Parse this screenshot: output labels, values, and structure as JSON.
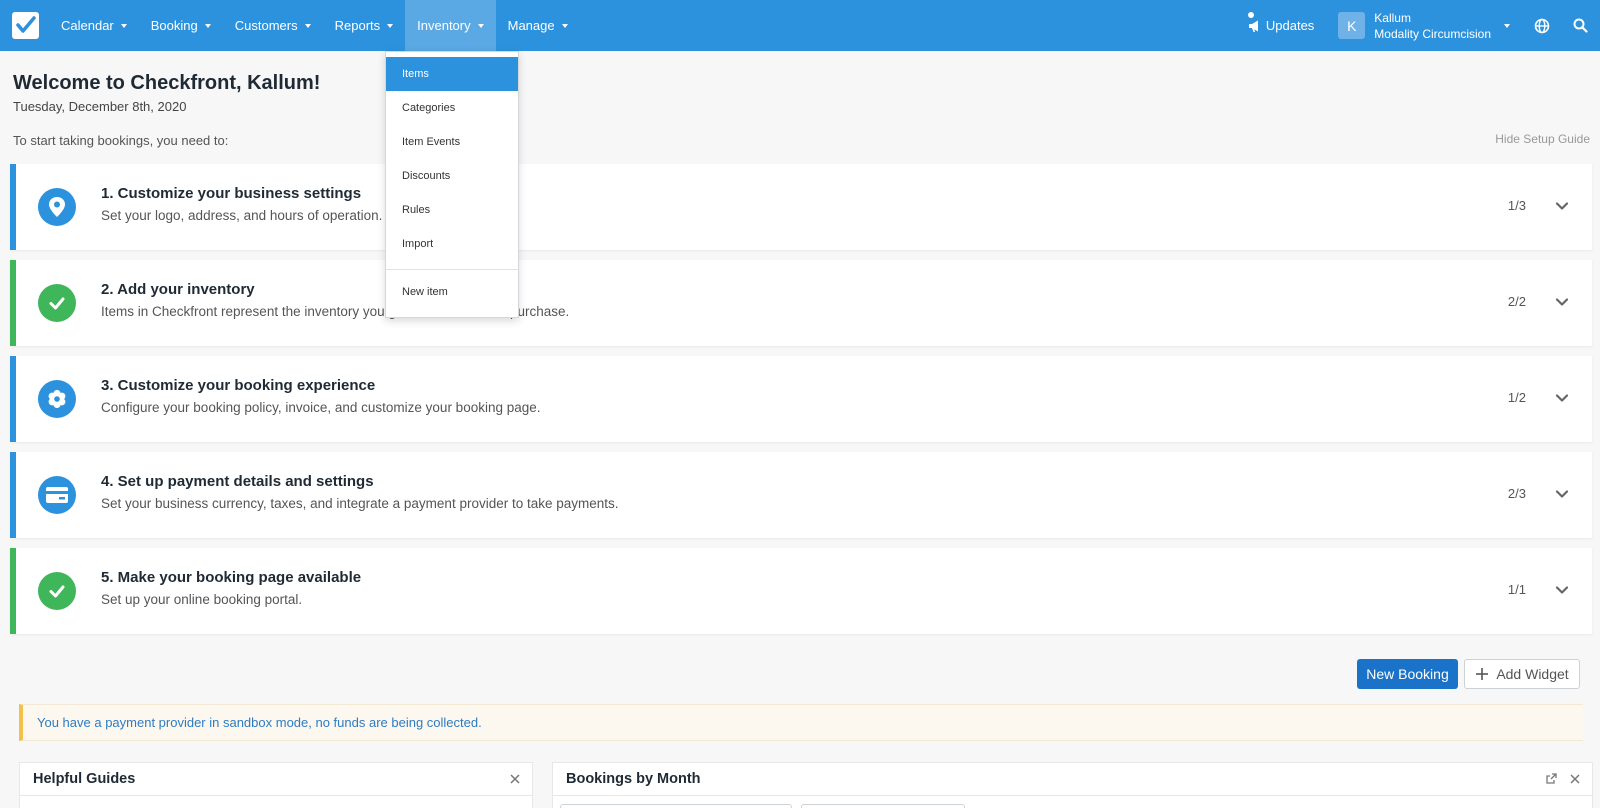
{
  "nav": {
    "items": [
      {
        "label": "Calendar"
      },
      {
        "label": "Booking"
      },
      {
        "label": "Customers"
      },
      {
        "label": "Reports"
      },
      {
        "label": "Inventory"
      },
      {
        "label": "Manage"
      }
    ],
    "active": "Inventory",
    "updates_label": "Updates",
    "user": {
      "initial": "K",
      "name": "Kallum",
      "company": "Modality Circumcision"
    }
  },
  "inventory_menu": {
    "items": [
      "Items",
      "Categories",
      "Item Events",
      "Discounts",
      "Rules",
      "Import"
    ],
    "selected": "Items",
    "new_item": "New item"
  },
  "welcome": {
    "title": "Welcome to Checkfront, Kallum!",
    "date": "Tuesday, December 8th, 2020",
    "intro": "To start taking bookings, you need to:",
    "hide_guide": "Hide Setup Guide"
  },
  "steps": [
    {
      "title": "1. Customize your business settings",
      "desc": "Set your logo, address, and hours of operation.",
      "count": "1/3",
      "icon": "location-pin-icon",
      "done": false
    },
    {
      "title": "2. Add your inventory",
      "desc": "Items in Checkfront represent the inventory you guests can book, or purchase.",
      "count": "2/2",
      "icon": "checkmark-icon",
      "done": true
    },
    {
      "title": "3. Customize your booking experience",
      "desc": "Configure your booking policy, invoice, and customize your booking page.",
      "count": "1/2",
      "icon": "gear-icon",
      "done": false
    },
    {
      "title": "4. Set up payment details and settings",
      "desc": "Set your business currency, taxes, and integrate a payment provider to take payments.",
      "count": "2/3",
      "icon": "credit-card-icon",
      "done": false
    },
    {
      "title": "5. Make your booking page available",
      "desc": "Set up your online booking portal.",
      "count": "1/1",
      "icon": "checkmark-icon",
      "done": true
    }
  ],
  "actions": {
    "new_booking": "New Booking",
    "add_widget": "Add Widget"
  },
  "alert": "You have a payment provider in sandbox mode, no funds are being collected.",
  "widgets": {
    "helpful_guides": "Helpful Guides",
    "bookings_by_month": "Bookings by Month"
  },
  "colors": {
    "primary": "#2d92dd",
    "success": "#3fb65a",
    "warning": "#f3c14b",
    "button": "#1a73c8"
  }
}
